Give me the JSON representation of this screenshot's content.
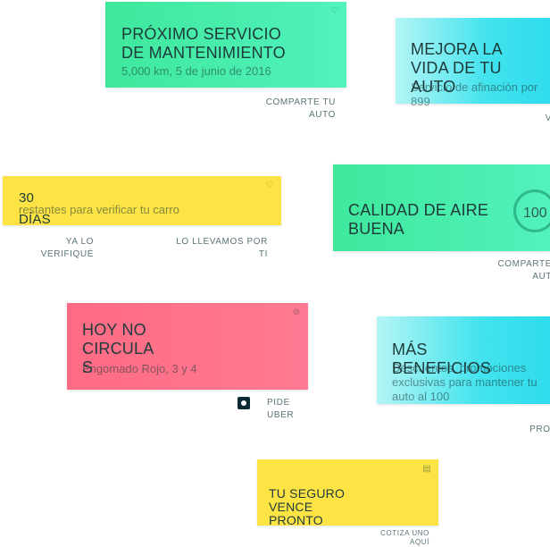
{
  "cards": {
    "maintenance": {
      "title": "PRÓXIMO SERVICIO DE MANTENIMIENTO",
      "subtitle": "5,000 km, 5 de junio de 2016",
      "action": "COMPARTE TU AUTO",
      "icon": "leaf-icon",
      "color": "#3ee89b"
    },
    "improve": {
      "title": "MEJORA LA VIDA DE TU AUTO",
      "subtitle": "Servicio de afinación por 899",
      "action": "V",
      "color": "#41e3ee"
    },
    "verify": {
      "title": "30 DÍAS",
      "subtitle": "restantes para verificar tu carro",
      "action_left": "YA LO VERIFIQUÉ",
      "action_right": "LO LLEVAMOS POR TI",
      "icon": "leaf-icon",
      "color": "#fde444"
    },
    "air": {
      "title": "CALIDAD DE AIRE BUENA",
      "gauge_value": "100",
      "action": "COMPARTE AUT",
      "color": "#3ee89b"
    },
    "nocircula": {
      "title": "HOY NO CIRCULA S",
      "subtitle": "Engomado Rojo, 3 y 4",
      "action": "PIDE UBER",
      "icon": "prohibited-icon",
      "color": "#ff6b84"
    },
    "benefits": {
      "title": "MÁS BENEFICIOS",
      "subtitle": "Descuentos, promociones exclusivas para mantener tu auto al 100",
      "action": "PROI",
      "color": "#41e3ee"
    },
    "insurance": {
      "title": "TU SEGURO VENCE PRONTO",
      "action": "COTIZA UNO AQUÍ",
      "icon": "document-icon",
      "color": "#fde444"
    }
  }
}
